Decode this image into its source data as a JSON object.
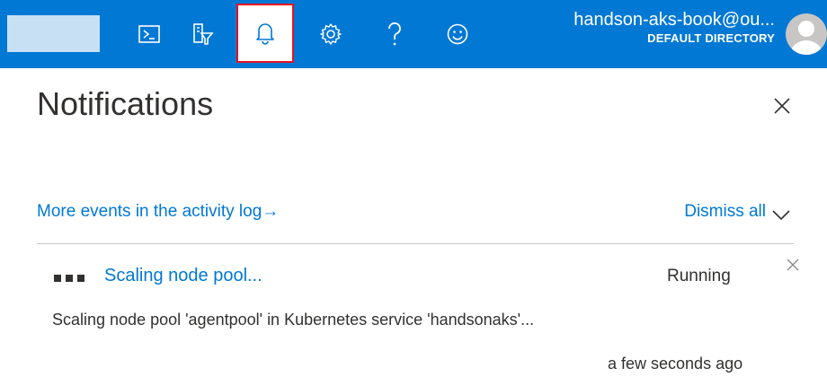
{
  "colors": {
    "accent": "#0078d4",
    "highlight_border": "#e81123",
    "text": "#323130"
  },
  "topbar": {
    "icons": [
      "cloud-shell-icon",
      "directory-filter-icon",
      "notifications-bell-icon",
      "settings-gear-icon",
      "help-question-icon",
      "feedback-smiley-icon"
    ],
    "account_name": "handson-aks-book@ou...",
    "directory": "DEFAULT DIRECTORY"
  },
  "panel": {
    "title": "Notifications",
    "activity_log_link": "More events in the activity log",
    "activity_log_arrow": "→",
    "dismiss_all": "Dismiss all"
  },
  "notifications": [
    {
      "title": "Scaling node pool...",
      "status": "Running",
      "description": "Scaling node pool 'agentpool' in Kubernetes service 'handsonaks'...",
      "time": "a few seconds ago"
    }
  ]
}
